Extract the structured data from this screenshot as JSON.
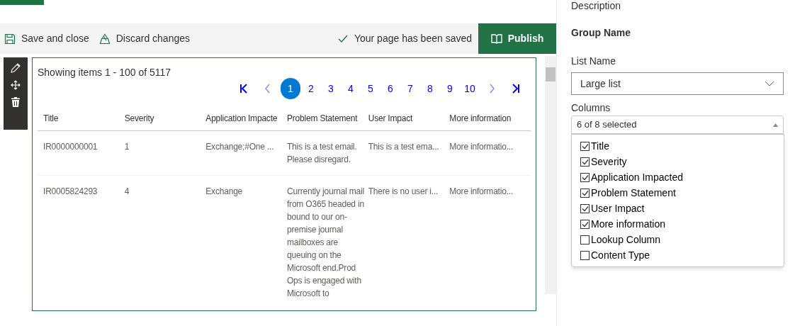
{
  "command_bar": {
    "save": "Save and close",
    "discard": "Discard changes",
    "status": "Your page has been saved",
    "publish": "Publish"
  },
  "web_part": {
    "summary": "Showing items 1 - 100 of 5117",
    "pages": [
      {
        "label": "1",
        "selected": true
      },
      {
        "label": "2",
        "selected": false
      },
      {
        "label": "3",
        "selected": false
      },
      {
        "label": "4",
        "selected": false
      },
      {
        "label": "5",
        "selected": false
      },
      {
        "label": "6",
        "selected": false
      },
      {
        "label": "7",
        "selected": false
      },
      {
        "label": "8",
        "selected": false
      },
      {
        "label": "9",
        "selected": false
      },
      {
        "label": "10",
        "selected": false
      }
    ],
    "table": {
      "columns": [
        "Title",
        "Severity",
        "Application Impacte",
        "Problem Statement",
        "User Impact",
        "More information"
      ],
      "rows": [
        [
          "IR0000000001",
          "1",
          "Exchange;#One ...",
          "This is a test email. Please disregard.",
          "This is a test ema...",
          "More informatio..."
        ],
        [
          "IR0005824293",
          "4",
          "Exchange",
          "Currently journal mail from O365 headed in bound to our on-premise journal mailboxes are queuing on the Microsoft end.Prod Ops is engaged with Microsoft to",
          "There is no user i...",
          "More informatio..."
        ]
      ]
    }
  },
  "property_pane": {
    "description_label": "Description",
    "group_name": "Group Name",
    "list_name_label": "List Name",
    "list_name_value": "Large list",
    "columns_label": "Columns",
    "columns_value": "6 of 8 selected",
    "column_options": [
      {
        "label": "Title",
        "checked": true
      },
      {
        "label": "Severity",
        "checked": true
      },
      {
        "label": "Application Impacted",
        "checked": true
      },
      {
        "label": "Problem Statement",
        "checked": true
      },
      {
        "label": "User Impact",
        "checked": true
      },
      {
        "label": "More information",
        "checked": true
      },
      {
        "label": "Lookup Column",
        "checked": false
      },
      {
        "label": "Content Type",
        "checked": false
      }
    ]
  }
}
